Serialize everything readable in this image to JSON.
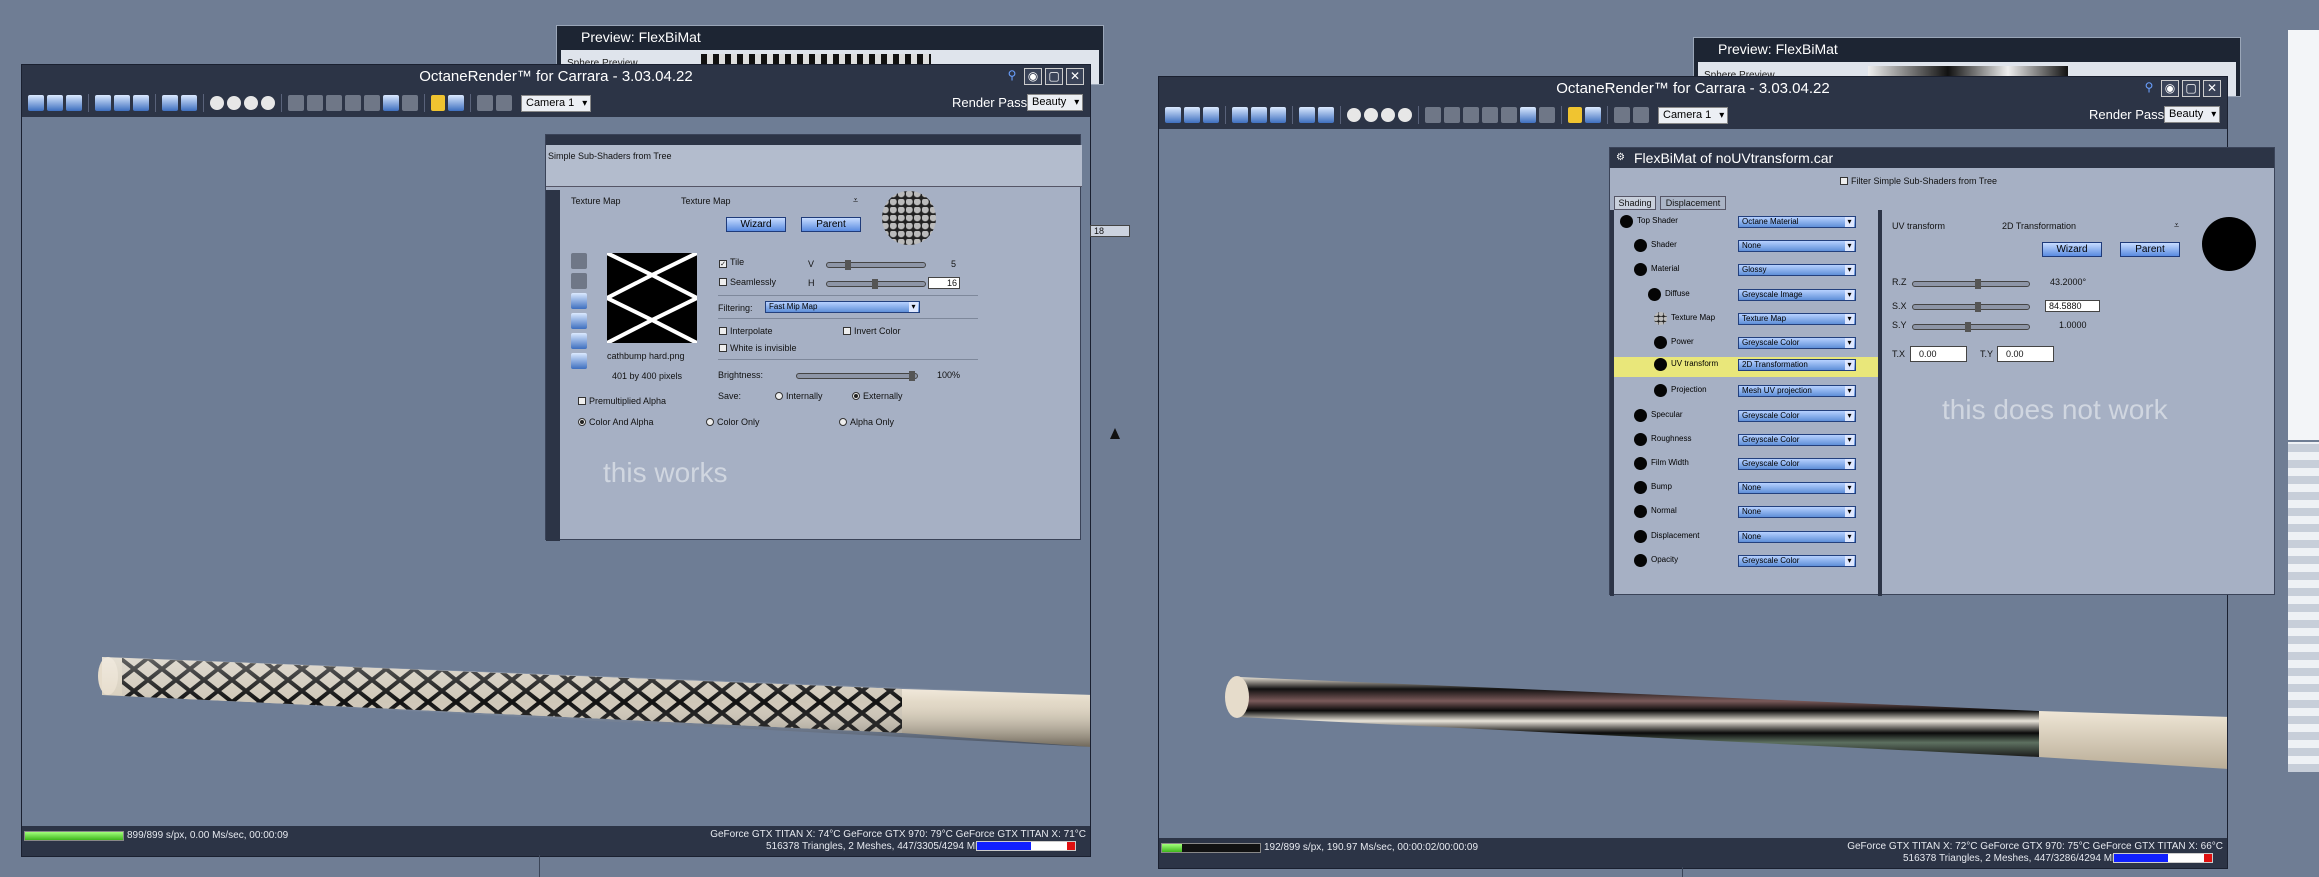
{
  "preview_left": {
    "title": "Preview: FlexBiMat",
    "body_label": "Sphere Preview"
  },
  "preview_right": {
    "title": "Preview: FlexBiMat",
    "body_label": "Sphere Preview"
  },
  "octane_left": {
    "title": "OctaneRender™ for Carrara - 3.03.04.22",
    "camera": "Camera 1",
    "render_pass_label": "Render Pass",
    "render_pass_value": "Beauty",
    "progress": 1.0,
    "status_left": "899/899 s/px, 0.00 Ms/sec, 00:00:09",
    "gpu_line": "GeForce GTX TITAN X: 74°C  GeForce GTX 970: 79°C  GeForce GTX TITAN X: 71°C",
    "mesh_line": "516378 Triangles, 2 Meshes, 447/3305/4294 MB"
  },
  "octane_right": {
    "title": "OctaneRender™ for Carrara - 3.03.04.22",
    "camera": "Camera 1",
    "render_pass_label": "Render Pass",
    "render_pass_value": "Beauty",
    "progress": 0.2,
    "status_left": "192/899 s/px, 190.97 Ms/sec, 00:00:02/00:00:09",
    "gpu_line": "GeForce GTX TITAN X: 72°C  GeForce GTX 970: 75°C  GeForce GTX TITAN X: 66°C",
    "mesh_line": "516378 Triangles, 2 Meshes, 447/3286/4294 MB"
  },
  "texture_panel": {
    "filter_label": "Simple Sub-Shaders from Tree",
    "node_label": "Texture Map",
    "node_type": "Texture Map",
    "wizard": "Wizard",
    "parent": "Parent",
    "tile_label": "Tile",
    "v_label": "V",
    "v_value": "5",
    "seamless_label": "Seamlessly",
    "h_label": "H",
    "h_value": "16",
    "filtering_label": "Filtering:",
    "filtering_value": "Fast Mip Map",
    "interpolate": "Interpolate",
    "invert": "Invert Color",
    "white_invisible": "White is invisible",
    "brightness_label": "Brightness:",
    "brightness_value": "100%",
    "save_label": "Save:",
    "save_internally": "Internally",
    "save_externally": "Externally",
    "filename": "cathbump hard.png",
    "dims": "401 by 400 pixels",
    "premultiplied": "Premultiplied Alpha",
    "color_alpha": "Color And Alpha",
    "color_only": "Color Only",
    "alpha_only": "Alpha Only",
    "note": "this works",
    "partial_value": "18"
  },
  "flex_panel": {
    "title": "FlexBiMat of noUVtransform.car",
    "filter_label": "Filter Simple Sub-Shaders from Tree",
    "tabs": [
      "Shading",
      "Displacement"
    ],
    "tree": [
      {
        "label": "Top Shader",
        "value": "Octane Material"
      },
      {
        "label": "Shader",
        "value": "None"
      },
      {
        "label": "Material",
        "value": "Glossy"
      },
      {
        "label": "Diffuse",
        "value": "Greyscale Image"
      },
      {
        "label": "Texture Map",
        "value": "Texture Map"
      },
      {
        "label": "Power",
        "value": "Greyscale Color"
      },
      {
        "label": "UV transform",
        "value": "2D Transformation"
      },
      {
        "label": "Projection",
        "value": "Mesh UV projection"
      },
      {
        "label": "Specular",
        "value": "Greyscale Color"
      },
      {
        "label": "Roughness",
        "value": "Greyscale Color"
      },
      {
        "label": "Film Width",
        "value": "Greyscale Color"
      },
      {
        "label": "Bump",
        "value": "None"
      },
      {
        "label": "Normal",
        "value": "None"
      },
      {
        "label": "Displacement",
        "value": "None"
      },
      {
        "label": "Opacity",
        "value": "Greyscale Color"
      }
    ],
    "node_label": "UV transform",
    "node_type": "2D Transformation",
    "wizard": "Wizard",
    "parent": "Parent",
    "rz_label": "R.Z",
    "rz_value": "43.2000°",
    "sx_label": "S.X",
    "sx_value": "84.5880",
    "sy_label": "S.Y",
    "sy_value": "1.0000",
    "tx_label": "T.X",
    "tx_value": "0.00",
    "ty_label": "T.Y",
    "ty_value": "0.00",
    "note": "this does not work"
  },
  "colors": {
    "highlight": "#e9e77a",
    "panel": "#a6b0c4",
    "window": "#2c3446",
    "desk": "#6f7d94"
  }
}
